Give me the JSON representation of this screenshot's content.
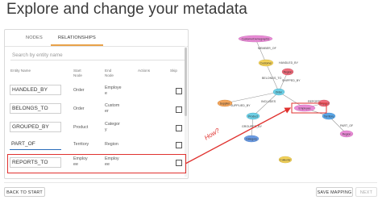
{
  "page": {
    "title": "Explore and change your metadata"
  },
  "tabs": [
    {
      "label": "NODES"
    },
    {
      "label": "RELATIONSHIPS"
    }
  ],
  "search": {
    "placeholder": "Search by entity name"
  },
  "table": {
    "headers": {
      "entity_name": "Entity Name",
      "start_node": "Start Node",
      "end_node": "End Node",
      "actions": "Actions",
      "skip": "Skip"
    },
    "rows": [
      {
        "name": "HANDLED_BY",
        "start": "Order",
        "end": "Employee"
      },
      {
        "name": "BELONGS_TO",
        "start": "Order",
        "end": "Customer"
      },
      {
        "name": "GROUPED_BY",
        "start": "Product",
        "end": "Category"
      },
      {
        "name": "PART_OF",
        "start": "Territory",
        "end": "Region"
      },
      {
        "name": "REPORTS_TO",
        "start": "Employee",
        "end": "Employee"
      }
    ]
  },
  "annotation": {
    "text": "How?"
  },
  "graph": {
    "nodes": [
      {
        "label": "CustomerDemographic",
        "color": "#e98bd6"
      },
      {
        "label": "Customer",
        "color": "#f3d25a"
      },
      {
        "label": "Region",
        "color": "#ef6b7a"
      },
      {
        "label": "Order",
        "color": "#6ed0e6"
      },
      {
        "label": "Supplier",
        "color": "#f2a55c"
      },
      {
        "label": "Employee",
        "color": "#e98bd6"
      },
      {
        "label": "Territory",
        "color": "#5aa7e8"
      },
      {
        "label": "Product",
        "color": "#6ed0e6"
      },
      {
        "label": "Category",
        "color": "#6a9be3"
      },
      {
        "label": "Shipper",
        "color": "#ef6b7a"
      },
      {
        "label": "Region",
        "color": "#e98bd6"
      },
      {
        "label": "Collector",
        "color": "#f3d25a"
      }
    ],
    "edges": [
      {
        "label": "MEMBER_OF"
      },
      {
        "label": "BELONGS_TO"
      },
      {
        "label": "HANDLED_BY"
      },
      {
        "label": "SHIPPED_BY"
      },
      {
        "label": "INCLUDES"
      },
      {
        "label": "SUPPLIED_BY"
      },
      {
        "label": "REPORTS_TO"
      },
      {
        "label": "GROUPED_BY"
      },
      {
        "label": "PART_OF"
      }
    ]
  },
  "footer": {
    "back": "BACK TO START",
    "save": "SAVE MAPPING",
    "next": "NEXT"
  }
}
